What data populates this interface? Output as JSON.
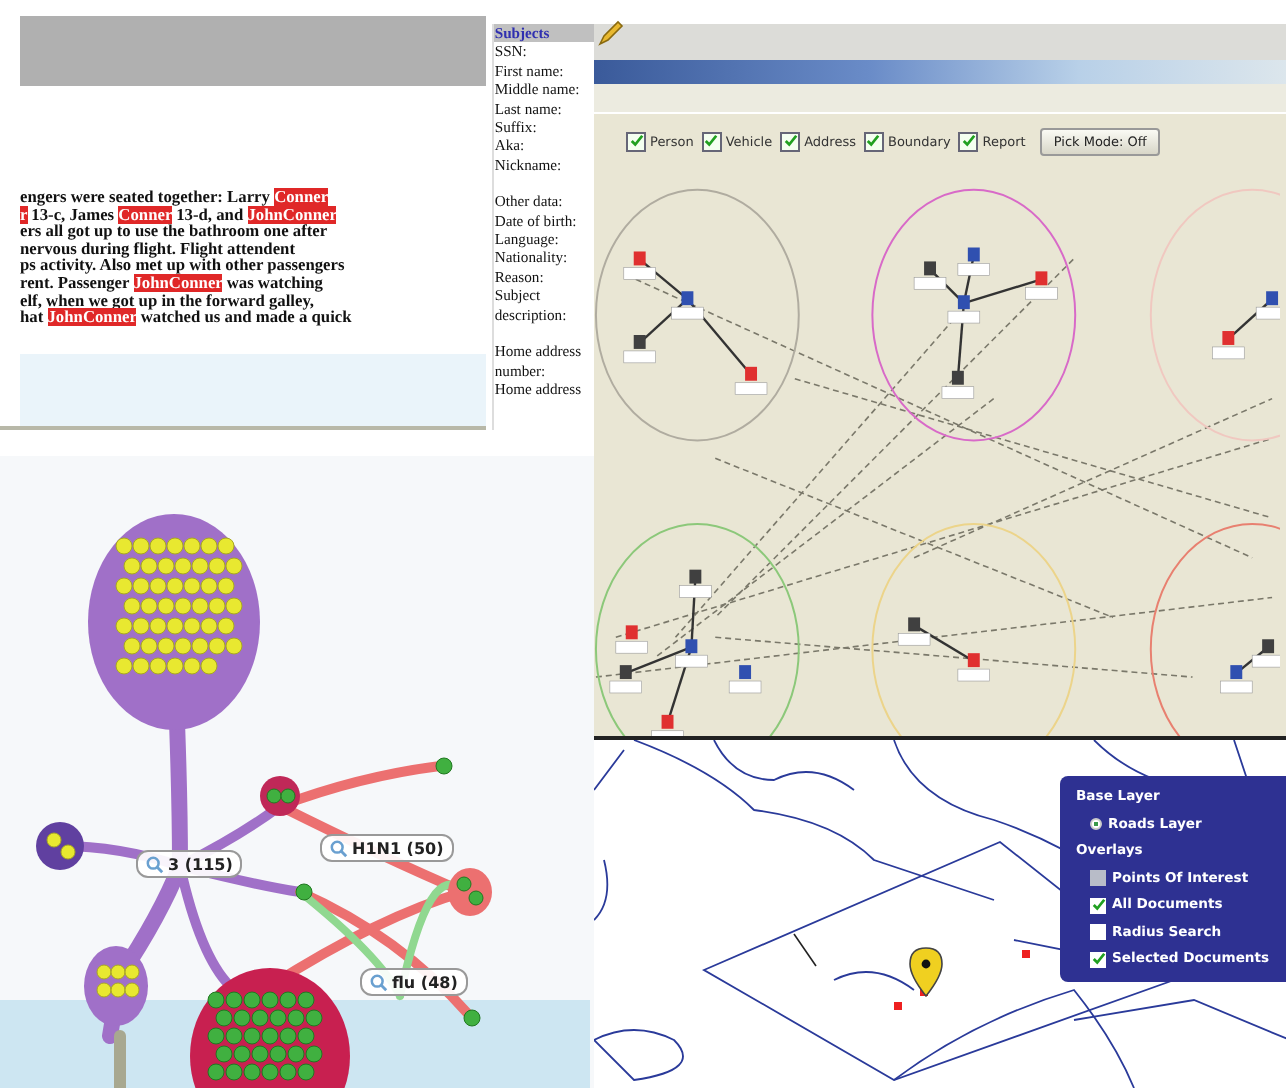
{
  "document_panel": {
    "text_lines": [
      [
        {
          "text": "engers were seated together: Larry ",
          "highlighted": false
        },
        {
          "text": "Conner",
          "highlighted": true
        }
      ],
      [
        {
          "text": "r",
          "highlighted": true
        },
        {
          "text": " 13-c, James ",
          "highlighted": false
        },
        {
          "text": "Conner",
          "highlighted": true
        },
        {
          "text": " 13-d, and ",
          "highlighted": false
        },
        {
          "text": "John",
          "highlighted": true
        },
        {
          "text": "Conner",
          "highlighted": true
        }
      ],
      [
        {
          "text": "ers all got up to use the bathroom one after",
          "highlighted": false
        }
      ],
      [
        {
          "text": "nervous during flight. Flight attendent",
          "highlighted": false
        }
      ],
      [
        {
          "text": "ps activity. Also met up with other passengers",
          "highlighted": false
        }
      ],
      [
        {
          "text": "rent. Passenger ",
          "highlighted": false
        },
        {
          "text": "John",
          "highlighted": true
        },
        {
          "text": "Conner",
          "highlighted": true
        },
        {
          "text": " was watching",
          "highlighted": false
        }
      ],
      [
        {
          "text": "elf, when we got up in the forward galley,",
          "highlighted": false
        }
      ],
      [
        {
          "text": "hat ",
          "highlighted": false
        },
        {
          "text": "John",
          "highlighted": true
        },
        {
          "text": "Conner",
          "highlighted": true
        },
        {
          "text": " watched us and made a quick",
          "highlighted": false
        }
      ]
    ],
    "subjects": {
      "title": "Subjects",
      "sections": [
        [
          "SSN:",
          "First name:",
          "Middle name:",
          "Last name:",
          "Suffix:",
          "Aka:",
          "Nickname:"
        ],
        [
          "Other data:",
          "Date of birth:",
          "Language:",
          "Nationality:",
          "Reason:",
          "Subject description:"
        ],
        [
          "Home address number:",
          "Home address"
        ]
      ]
    }
  },
  "link_chart": {
    "filters": [
      {
        "label": "Person",
        "checked": true
      },
      {
        "label": "Vehicle",
        "checked": true
      },
      {
        "label": "Address",
        "checked": true
      },
      {
        "label": "Boundary",
        "checked": true
      },
      {
        "label": "Report",
        "checked": true
      }
    ],
    "pick_mode_button": "Pick Mode: Off",
    "clusters": [
      {
        "color": "#b0aca0"
      },
      {
        "color": "#d86ac8"
      },
      {
        "color": "#f0c8c0"
      },
      {
        "color": "#8cc87a"
      },
      {
        "color": "#ecd48a"
      },
      {
        "color": "#e88070"
      }
    ]
  },
  "bubble_tree": {
    "labels": [
      "3 (115)",
      "H1N1 (50)",
      "flu (48)"
    ]
  },
  "map": {
    "layers_panel": {
      "base_title": "Base Layer",
      "base_layers": [
        {
          "label": "Roads Layer",
          "selected": true
        }
      ],
      "overlays_title": "Overlays",
      "overlays": [
        {
          "label": "Points Of Interest",
          "checked": false,
          "disabled": true
        },
        {
          "label": "All Documents",
          "checked": true,
          "disabled": false
        },
        {
          "label": "Radius Search",
          "checked": false,
          "disabled": false
        },
        {
          "label": "Selected Documents",
          "checked": true,
          "disabled": false
        }
      ]
    }
  }
}
